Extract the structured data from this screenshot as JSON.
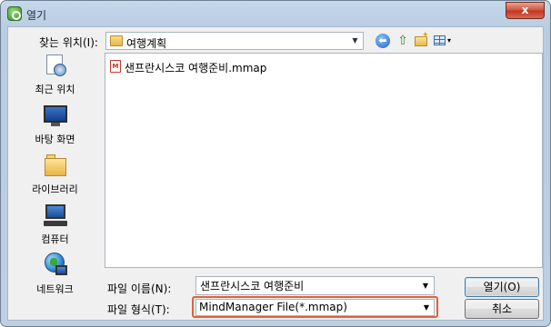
{
  "window": {
    "title": "열기",
    "close_symbol": "x"
  },
  "toolbar": {
    "look_in_label": "찾는 위치(I):",
    "look_in_value": "여행계획",
    "back_symbol": "⬅",
    "up_symbol": "⇧",
    "views_arrow": "▾"
  },
  "places": [
    {
      "label": "최근 위치",
      "icon": "recent-places-icon"
    },
    {
      "label": "바탕 화면",
      "icon": "desktop-icon"
    },
    {
      "label": "라이브러리",
      "icon": "libraries-icon"
    },
    {
      "label": "컴퓨터",
      "icon": "computer-icon"
    },
    {
      "label": "네트워크",
      "icon": "network-icon"
    }
  ],
  "files": [
    {
      "name": "샌프란시스코 여행준비.mmap",
      "icon": "mindmanager-file-icon",
      "icon_glyph": "M"
    }
  ],
  "form": {
    "file_name_label": "파일 이름(N):",
    "file_name_value": "샌프란시스코 여행준비",
    "file_type_label": "파일 형식(T):",
    "file_type_value": "MindManager File(*.mmap)",
    "highlight_color": "#e2603c"
  },
  "buttons": {
    "open": "열기(O)",
    "cancel": "취소"
  },
  "dropdown_arrow": "▼"
}
